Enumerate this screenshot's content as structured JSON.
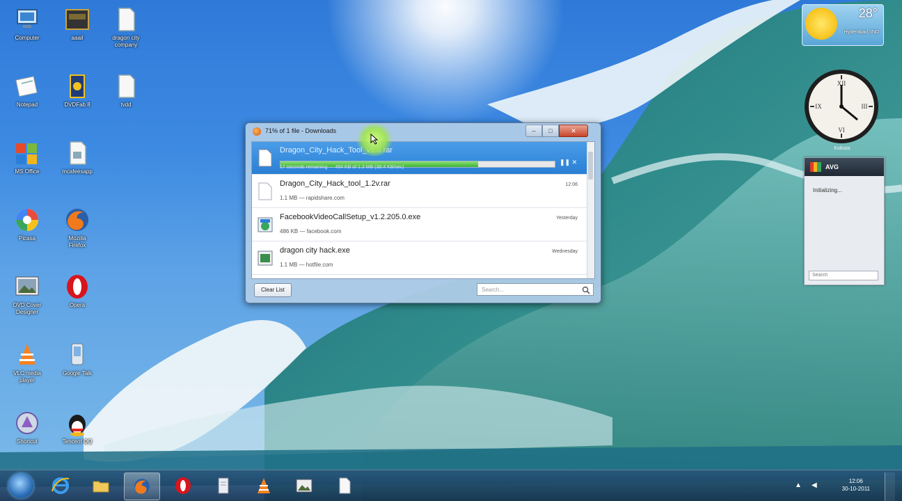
{
  "desktop_icons": [
    {
      "label": "Computer",
      "icon": "computer-icon"
    },
    {
      "label": "aaail",
      "icon": "app-icon"
    },
    {
      "label": "dragon city\ncompany",
      "icon": "document-icon"
    },
    {
      "label": "Notepad",
      "icon": "notepad-icon"
    },
    {
      "label": "DVDFab 8",
      "icon": "dvd-icon"
    },
    {
      "label": "tvdd",
      "icon": "document-icon"
    },
    {
      "label": "MS Office",
      "icon": "office-icon"
    },
    {
      "label": "mcafeesapp",
      "icon": "document-icon"
    },
    {
      "label": "Picasa",
      "icon": "picasa-icon"
    },
    {
      "label": "Mozilla\nFirefox",
      "icon": "firefox-icon"
    },
    {
      "label": "DVD Cover\nDesigner",
      "icon": "image-icon"
    },
    {
      "label": "Opera",
      "icon": "opera-icon"
    },
    {
      "label": "VLC media\nplayer",
      "icon": "vlc-icon"
    },
    {
      "label": "Google Talk",
      "icon": "phone-icon"
    },
    {
      "label": "Shortcut",
      "icon": "app-icon"
    },
    {
      "label": "Tencent QQ",
      "icon": "qq-icon"
    }
  ],
  "weather": {
    "temp": "28°",
    "city": "Hyderabad, IND"
  },
  "clock": {
    "label": "Kolkata"
  },
  "antivirus": {
    "name": "AVG",
    "status": "Initializing...",
    "search_placeholder": "Search"
  },
  "downloads": {
    "title": "71% of 1 file - Downloads",
    "buttons": {
      "minimize": "–",
      "maximize": "□",
      "close": "✕"
    },
    "progress": 0.72,
    "items": [
      {
        "name": "Dragon_City_Hack_Tool_v1.0.rar",
        "meta": "17 seconds remaining — 484 KB of 1.3 MB (38.4 KB/sec)",
        "time": "",
        "icon": "file-icon",
        "active": true
      },
      {
        "name": "Dragon_City_Hack_tool_1.2v.rar",
        "meta": "1.1 MB — rapidshare.com",
        "time": "12:06",
        "icon": "file-icon",
        "active": false
      },
      {
        "name": "FacebookVideoCallSetup_v1.2.205.0.exe",
        "meta": "486 KB — facebook.com",
        "time": "Yesterday",
        "icon": "installer-icon",
        "active": false
      },
      {
        "name": "dragon city hack.exe",
        "meta": "1.1 MB — hotfile.com",
        "time": "Wednesday",
        "icon": "exe-icon",
        "active": false
      }
    ],
    "clear_list": "Clear List",
    "search_placeholder": "Search..."
  },
  "taskbar": {
    "apps": [
      "ie-icon",
      "folder-icon",
      "firefox-icon",
      "opera-icon",
      "notepad-icon",
      "vlc-icon",
      "image-icon",
      "document-icon"
    ],
    "active_app": "firefox-icon",
    "time": "12:06",
    "date": "30-10-2011"
  },
  "colors": {
    "accent": "#2a7fd4",
    "progress": "#3cb23a",
    "window_frame": "#b2cde8"
  }
}
